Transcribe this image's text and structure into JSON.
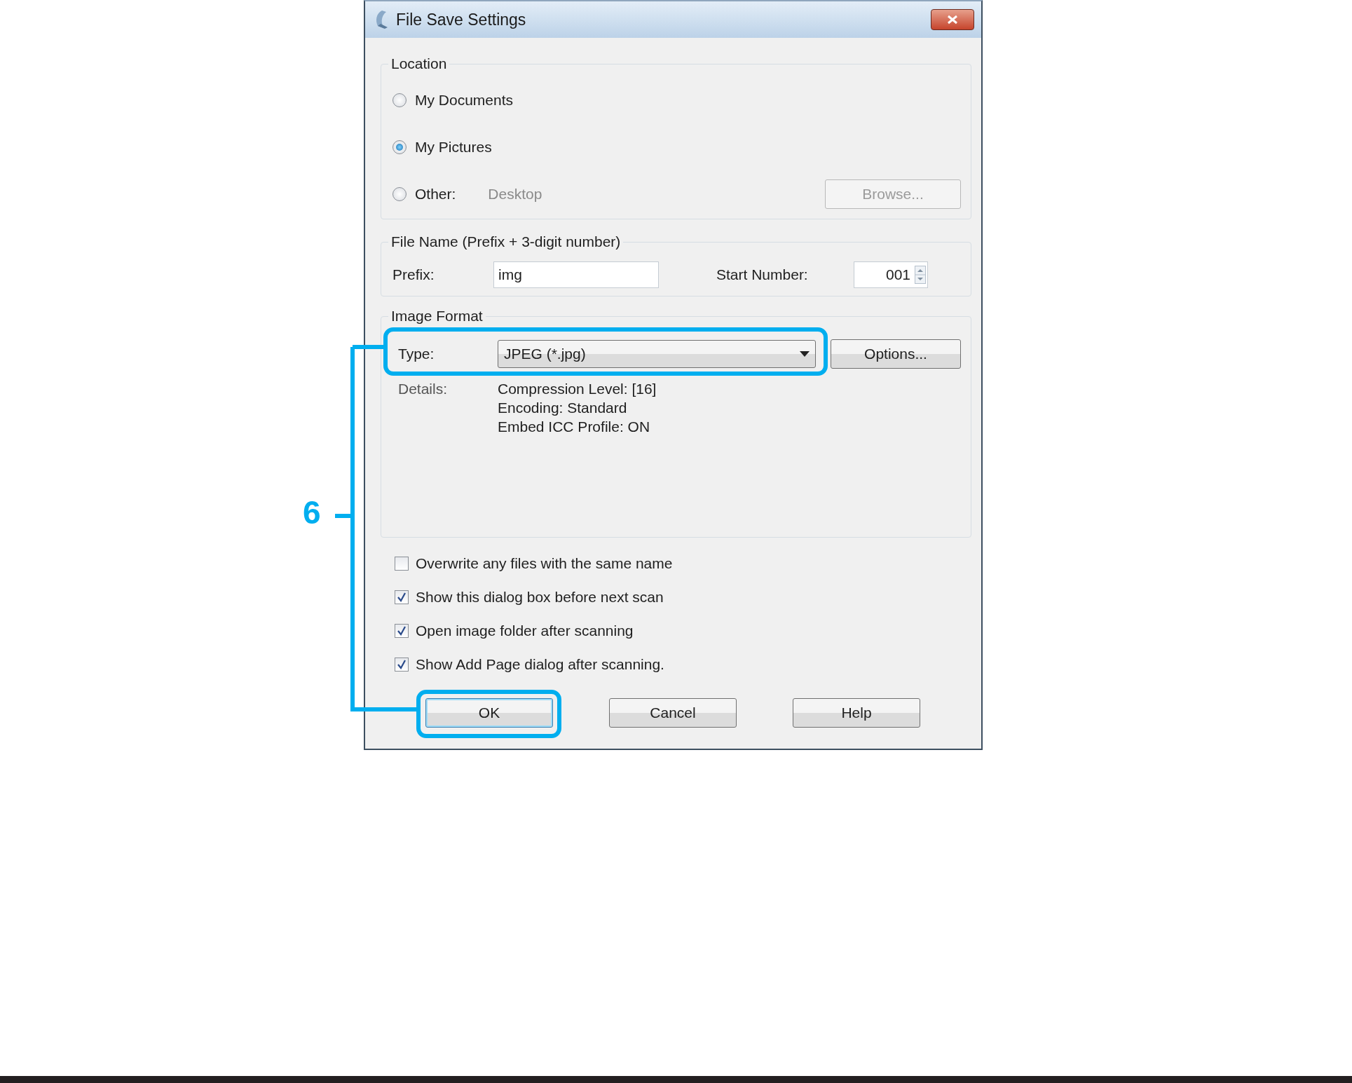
{
  "window": {
    "title": "File Save Settings"
  },
  "location": {
    "label": "Location",
    "options": [
      {
        "label": "My Documents",
        "selected": false
      },
      {
        "label": "My Pictures",
        "selected": true
      },
      {
        "label": "Other:",
        "selected": false,
        "value": "Desktop"
      }
    ],
    "browse_button": {
      "label": "Browse...",
      "disabled": true
    }
  },
  "file_name": {
    "label": "File Name (Prefix + 3-digit number)",
    "prefix_label": "Prefix:",
    "prefix": "img",
    "start_label": "Start Number:",
    "start": "001"
  },
  "image_format": {
    "label": "Image Format",
    "type_label": "Type:",
    "type": "JPEG (*.jpg)",
    "options_button": "Options...",
    "details_label": "Details:",
    "details": [
      "Compression Level: [16]",
      "Encoding: Standard",
      "Embed ICC Profile: ON"
    ]
  },
  "checkboxes": [
    {
      "label": "Overwrite any files with the same name",
      "checked": false
    },
    {
      "label": "Show this dialog box before next scan",
      "checked": true
    },
    {
      "label": "Open image folder after scanning",
      "checked": true
    },
    {
      "label": "Show Add Page dialog after scanning.",
      "checked": true
    }
  ],
  "buttons": [
    {
      "label": "OK",
      "default": true
    },
    {
      "label": "Cancel",
      "default": false
    },
    {
      "label": "Help",
      "default": false
    }
  ],
  "callout": {
    "number": "6"
  }
}
